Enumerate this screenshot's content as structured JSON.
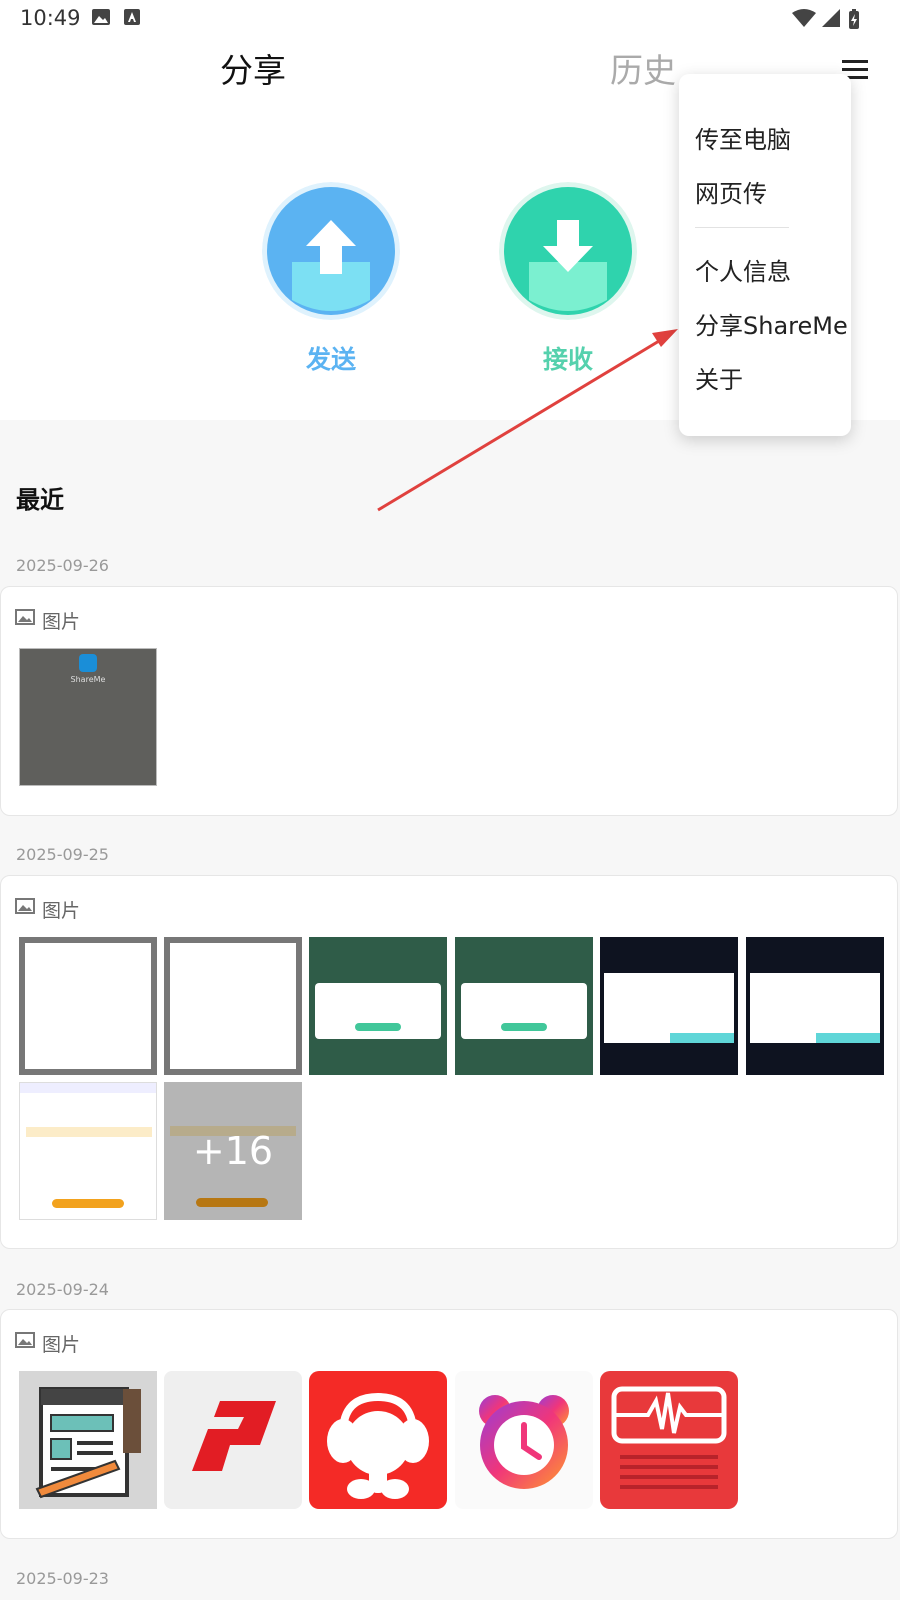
{
  "status_bar": {
    "time": "10:49"
  },
  "tabs": {
    "share": "分享",
    "history": "历史"
  },
  "actions": {
    "send_label": "发送",
    "receive_label": "接收"
  },
  "colors": {
    "send": "#5bb3f2",
    "receive": "#55d1ad",
    "annotation": "#e0413e"
  },
  "recent": {
    "title": "最近",
    "groups": [
      {
        "date": "2025-09-26",
        "type_label": "图片"
      },
      {
        "date": "2025-09-25",
        "type_label": "图片",
        "more_count": "+16"
      },
      {
        "date": "2025-09-24",
        "type_label": "图片"
      },
      {
        "date": "2025-09-23"
      }
    ],
    "thumb_text": {
      "shareme": "ShareMe"
    }
  },
  "menu": {
    "items": [
      "传至电脑",
      "网页传",
      "个人信息",
      "分享ShareMe",
      "关于"
    ]
  }
}
